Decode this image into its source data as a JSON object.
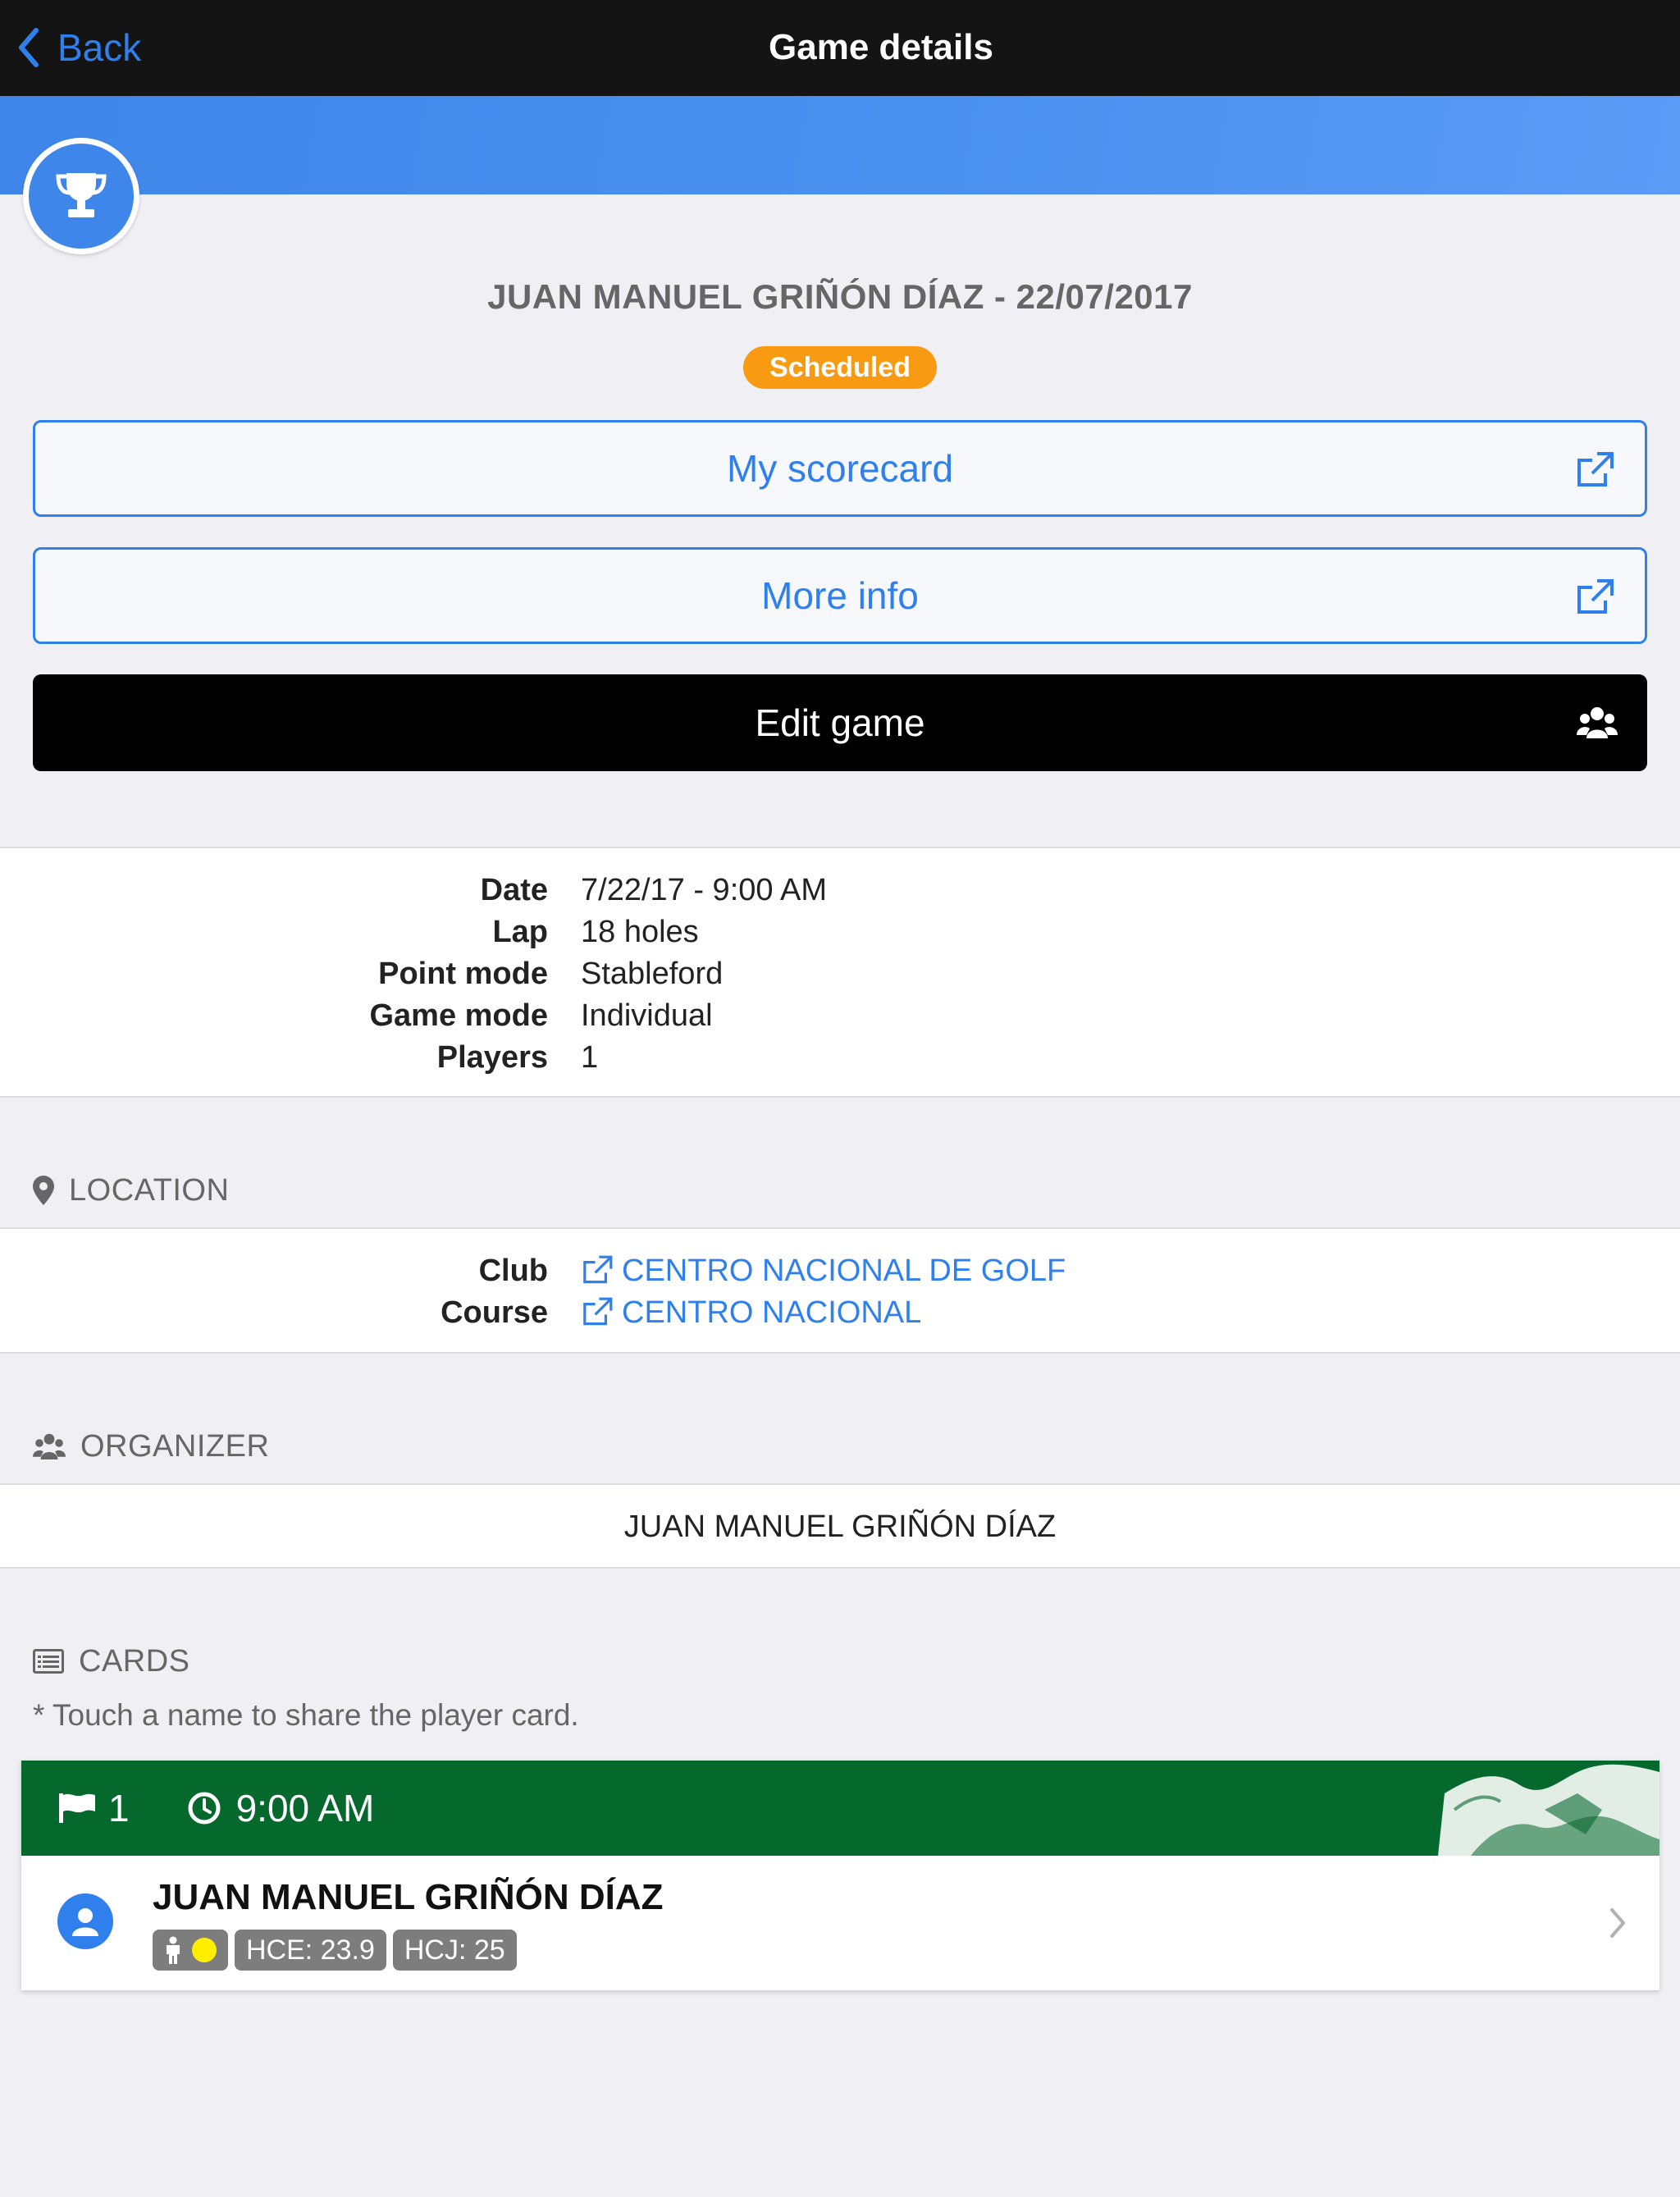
{
  "navbar": {
    "back_label": "Back",
    "title": "Game details"
  },
  "game": {
    "title": "JUAN MANUEL GRIÑÓN DÍAZ - 22/07/2017",
    "status": "Scheduled",
    "status_color": "#f89a12"
  },
  "actions": {
    "scorecard_label": "My scorecard",
    "more_info_label": "More info",
    "edit_label": "Edit game"
  },
  "details": [
    {
      "key": "Date",
      "value": "7/22/17 - 9:00 AM"
    },
    {
      "key": "Lap",
      "value": "18 holes"
    },
    {
      "key": "Point mode",
      "value": "Stableford"
    },
    {
      "key": "Game mode",
      "value": "Individual"
    },
    {
      "key": "Players",
      "value": "1"
    }
  ],
  "location": {
    "header": "LOCATION",
    "club_key": "Club",
    "club_value": "CENTRO NACIONAL DE GOLF",
    "course_key": "Course",
    "course_value": "CENTRO NACIONAL"
  },
  "organizer": {
    "header": "ORGANIZER",
    "name": "JUAN MANUEL GRIÑÓN DÍAZ"
  },
  "cards": {
    "header": "CARDS",
    "hint": "* Touch a name to share the player card.",
    "items": [
      {
        "hole": "1",
        "time": "9:00 AM",
        "player": "JUAN MANUEL GRIÑÓN DÍAZ",
        "hce": "HCE: 23.9",
        "hcj": "HCJ: 25"
      }
    ]
  },
  "colors": {
    "accent": "#2f80ed",
    "card_header": "#05682d",
    "navbar": "#141414",
    "banner": "#4a90ef",
    "tee": "#ffee00"
  }
}
